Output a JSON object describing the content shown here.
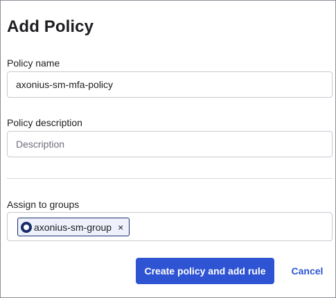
{
  "dialog": {
    "title": "Add Policy"
  },
  "form": {
    "policy_name": {
      "label": "Policy name",
      "value": "axonius-sm-mfa-policy"
    },
    "policy_description": {
      "label": "Policy description",
      "placeholder": "Description",
      "value": ""
    },
    "assign_groups": {
      "label": "Assign to groups",
      "chips": [
        {
          "label": "axonius-sm-group",
          "icon": "group-icon",
          "remove_glyph": "×"
        }
      ]
    }
  },
  "actions": {
    "primary_label": "Create policy and add rule",
    "cancel_label": "Cancel"
  },
  "colors": {
    "primary": "#2f54d3",
    "chip_border": "#1a2d6b",
    "chip_bg": "#eef1fb"
  }
}
